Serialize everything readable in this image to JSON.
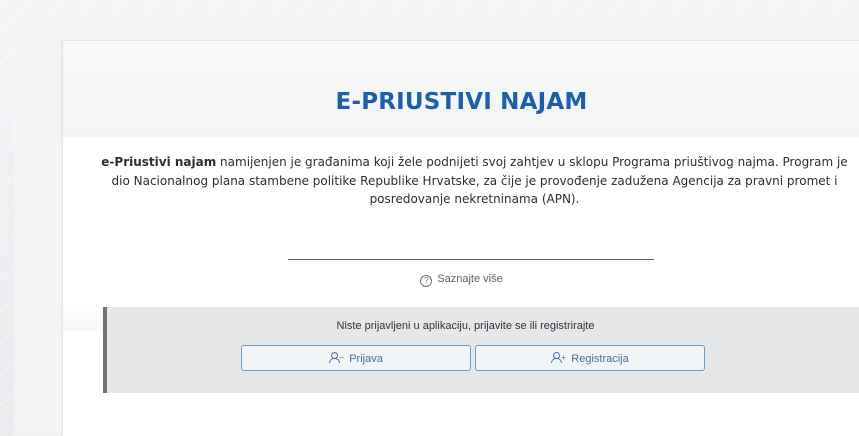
{
  "header": {
    "title": "E-PRIUSTIVI NAJAM"
  },
  "intro": {
    "lead_bold": "e-Priustivi najam",
    "text": " namijenjen je građanima koji žele podnijeti svoj zahtjev u sklopu Programa priuštivog najma. Program je dio Nacionalnog plana stambene politike Republike Hrvatske, za čije je provođenje zadužena Agencija za pravni promet i posredovanje nekretninama (APN)."
  },
  "learn_more": {
    "label": "Saznajte više",
    "icon": "question-circle-icon"
  },
  "auth": {
    "message": "Niste prijavljeni u aplikaciju, prijavite se ili registrirajte",
    "login_label": "Prijava",
    "login_icon": "user-minus-icon",
    "register_label": "Registracija",
    "register_icon": "user-plus-icon"
  },
  "colors": {
    "title": "#1d5fa8",
    "button_border": "#6e9cc9",
    "panel_bg": "#e6e7e9",
    "panel_accent": "#6f7377"
  }
}
